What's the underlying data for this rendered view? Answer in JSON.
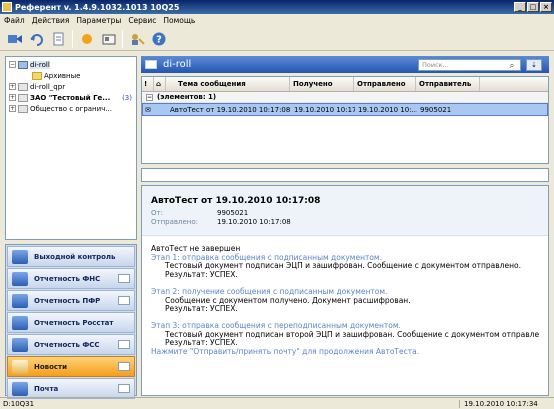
{
  "window": {
    "title": "Референт v. 1.4.9.1032.1013 10Q25"
  },
  "menu": [
    "Файл",
    "Действия",
    "Параметры",
    "Сервис",
    "Помощь"
  ],
  "toolbar": {
    "icons": [
      "send-receive-icon",
      "refresh-icon",
      "compose-icon",
      "sun-icon",
      "card-icon",
      "key-user-icon",
      "help-icon"
    ]
  },
  "tree": {
    "items": [
      {
        "label": "di-roll",
        "expander": "−",
        "count": ""
      },
      {
        "label": "Архивные",
        "expander": "",
        "count": ""
      },
      {
        "label": "di-roll_qpr",
        "expander": "+",
        "count": ""
      },
      {
        "label": "ЗАО \"Тестовый Ге...",
        "expander": "+",
        "count": "(3)"
      },
      {
        "label": "Общество с огранич...",
        "expander": "+",
        "count": ""
      }
    ]
  },
  "nav": {
    "items": [
      {
        "label": "Выходной контроль"
      },
      {
        "label": "Отчетность ФНС"
      },
      {
        "label": "Отчетность ПФР"
      },
      {
        "label": "Отчетность Росстат"
      },
      {
        "label": "Отчетность ФСС"
      },
      {
        "label": "Новости"
      },
      {
        "label": "Почта"
      }
    ]
  },
  "panel": {
    "title": "di-roll",
    "search_placeholder": "Поиск..."
  },
  "grid": {
    "columns": [
      "Тема сообщения",
      "Получено",
      "Отправлено",
      "Отправитель"
    ],
    "group": "(элементов: 1)",
    "rows": [
      {
        "subject": "АвтоТест от 19.10.2010 10:17:08",
        "received": "19.10.2010 10:17:...",
        "sent": "19.10.2010 10:...",
        "sender": "9905021"
      }
    ]
  },
  "preview": {
    "subject": "АвтоТест от 19.10.2010 10:17:08",
    "from_label": "От:",
    "from_value": "9905021",
    "sent_label": "Отправлено:",
    "sent_value": "19.10.2010 10:17:08",
    "lines": [
      "АвтоТест не завершен",
      "Этап 1: отправка сообщения с подписанным документом.",
      "Тестовый документ подписан ЭЦП и зашифрован. Сообщение с документом отправлено.",
      "Результат: УСПЕХ.",
      "Этап 2: получение сообщения с подписанным документом.",
      "Сообщение с документом получено. Документ расшифрован.",
      "Результат: УСПЕХ.",
      "Этап 3: отправка сообщения с переподписанным документом.",
      "Тестовый документ подписан второй ЭЦП и зашифрован. Сообщение с документом отправле",
      "Результат: УСПЕХ.",
      "Нажмите \"Отправить/принять почту\" для продолжения АвтоТеста."
    ]
  },
  "status": {
    "left": "D:10Q31",
    "right": "19.10.2010 10:17:34"
  }
}
